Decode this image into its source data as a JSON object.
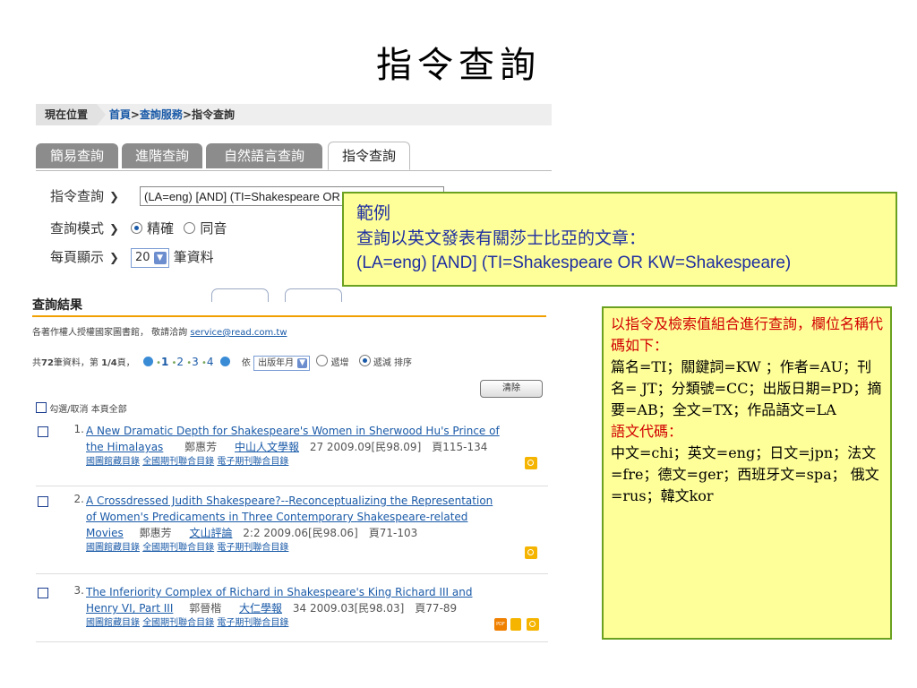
{
  "slide": {
    "title": "指令查詢"
  },
  "breadcrumb": {
    "label": "現在位置",
    "home": "首頁",
    "sep1": ">",
    "service": "查詢服務",
    "sep2": ">",
    "current": "指令查詢"
  },
  "tabs": [
    {
      "label": "簡易查詢"
    },
    {
      "label": "進階查詢"
    },
    {
      "label": "自然語言查詢"
    },
    {
      "label": "指令查詢"
    }
  ],
  "form": {
    "command_label": "指令查詢",
    "command_value": "(LA=eng) [AND] (TI=Shakespeare OR KW=Shakespeare)",
    "mode_label": "查詢模式",
    "mode_exact": "精確",
    "mode_homophone": "同音",
    "perpage_label": "每頁顯示",
    "perpage_value": "20",
    "perpage_suffix": "筆資料",
    "chevron": "❯"
  },
  "callout_example": {
    "line1": "範例",
    "line2": "查詢以英文發表有關莎士比亞的文章：",
    "line3": "(LA=eng) [AND] (TI=Shakespeare OR KW=Shakespeare)"
  },
  "callout_codes": {
    "red1": "以指令及檢索值組合進行查詢，欄位名稱代碼如下：",
    "black1": "篇名=TI；關鍵詞=KW ；作者=AU；刊名= JT；分類號=CC；出版日期=PD；摘要=AB；全文=TX；作品語文=LA",
    "red2": "語文代碼：",
    "black2": "中文=chi；英文=eng；日文=jpn；法文=fre；德文=ger；西班牙文=spa； 俄文=rus；韓文kor"
  },
  "results": {
    "title": "查詢結果",
    "notice": "各著作權人授權國家圖書館， 敬請洽詢 ",
    "notice_email": "service@read.com.tw",
    "count_prefix": "共",
    "count_total": "72",
    "count_mid": "筆資料，第",
    "count_page": "1/4",
    "count_suffix": "頁，",
    "pages": [
      "1",
      "2",
      "3",
      "4"
    ],
    "sort_by_label": "依",
    "sort_field": "出版年月",
    "sort_asc": "遞增",
    "sort_desc": "遞減",
    "sort_suffix": "排序",
    "clear_button": "清除",
    "select_all": "勾選/取消 本頁全部",
    "link_a": "國圖館藏目錄",
    "link_b": "全國期刊聯合目錄",
    "link_c": "電子期刊聯合目錄",
    "items": [
      {
        "no": "1.",
        "title1": "A New Dramatic Depth for Shakespeare's Women in Sherwood Hu's Prince of",
        "title2": "the Himalayas",
        "author": "鄭惠芳",
        "journal": "中山人文學報",
        "meta": "27 2009.09[民98.09]　頁115-134"
      },
      {
        "no": "2.",
        "title1": "A Crossdressed Judith Shakespeare?--Reconceptualizing the Representation",
        "title2": "of Women's Predicaments in Three Contemporary Shakespeare-related",
        "title3": "Movies",
        "author": "鄭惠芳",
        "journal": "文山評論",
        "meta": "2:2 2009.06[民98.06]　頁71-103"
      },
      {
        "no": "3.",
        "title1": "The Inferiority Complex of Richard in Shakespeare's King Richard III and",
        "title2": "Henry VI, Part III",
        "author": "郭晉楷",
        "journal": "大仁學報",
        "meta": "34 2009.03[民98.03]　頁77-89",
        "pdf": "PDF"
      }
    ]
  }
}
